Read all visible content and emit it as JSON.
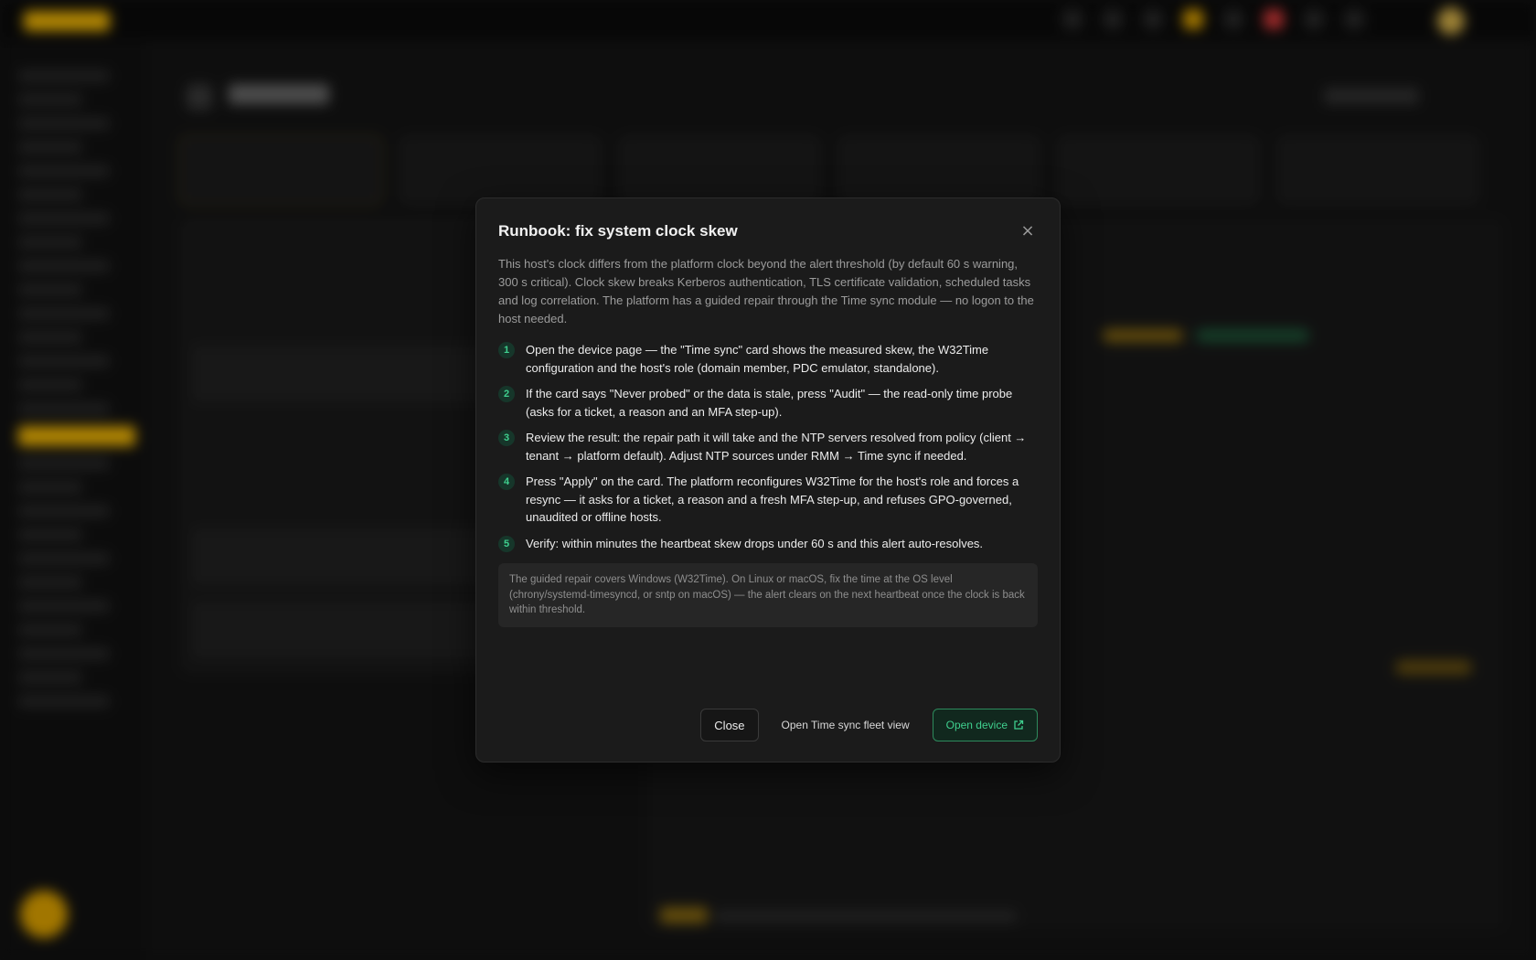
{
  "modal": {
    "title": "Runbook: fix system clock skew",
    "intro": "This host's clock differs from the platform clock beyond the alert threshold (by default 60 s warning, 300 s critical). Clock skew breaks Kerberos authentication, TLS certificate validation, scheduled tasks and log correlation. The platform has a guided repair through the Time sync module — no logon to the host needed.",
    "steps": [
      {
        "num": "1",
        "text": "Open the device page — the \"Time sync\" card shows the measured skew, the W32Time configuration and the host's role (domain member, PDC emulator, standalone)."
      },
      {
        "num": "2",
        "text": "If the card says \"Never probed\" or the data is stale, press \"Audit\" — the read-only time probe (asks for a ticket, a reason and an MFA step-up)."
      },
      {
        "num": "3",
        "text": "Review the result: the repair path it will take and the NTP servers resolved from policy (client → tenant → platform default). Adjust NTP sources under RMM → Time sync if needed."
      },
      {
        "num": "4",
        "text": "Press \"Apply\" on the card. The platform reconfigures W32Time for the host's role and forces a resync — it asks for a ticket, a reason and a fresh MFA step-up, and refuses GPO-governed, unaudited or offline hosts."
      },
      {
        "num": "5",
        "text": "Verify: within minutes the heartbeat skew drops under 60 s and this alert auto-resolves."
      }
    ],
    "note": "The guided repair covers Windows (W32Time). On Linux or macOS, fix the time at the OS level (chrony/systemd-timesyncd, or sntp on macOS) — the alert clears on the next heartbeat once the clock is back within threshold.",
    "buttons": {
      "close": "Close",
      "fleet": "Open Time sync fleet view",
      "device": "Open device"
    },
    "close_icon": "×"
  },
  "colors": {
    "accent": "#f2b705",
    "success": "#3fcf8e"
  }
}
